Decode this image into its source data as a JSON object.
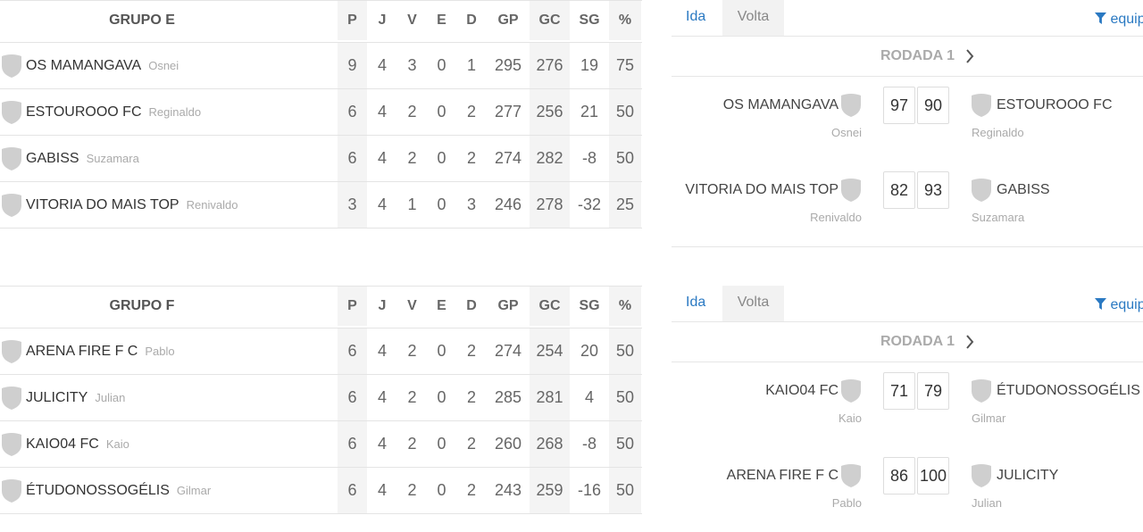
{
  "standings_columns": [
    "P",
    "J",
    "V",
    "E",
    "D",
    "GP",
    "GC",
    "SG",
    "%"
  ],
  "groups": [
    {
      "title": "GRUPO E",
      "rows": [
        {
          "team": "OS MAMANGAVA",
          "owner": "Osnei",
          "stats": [
            "9",
            "4",
            "3",
            "0",
            "1",
            "295",
            "276",
            "19",
            "75"
          ]
        },
        {
          "team": "ESTOUROOO FC",
          "owner": "Reginaldo",
          "stats": [
            "6",
            "4",
            "2",
            "0",
            "2",
            "277",
            "256",
            "21",
            "50"
          ]
        },
        {
          "team": "GABISS",
          "owner": "Suzamara",
          "stats": [
            "6",
            "4",
            "2",
            "0",
            "2",
            "274",
            "282",
            "-8",
            "50"
          ]
        },
        {
          "team": "VITORIA DO MAIS TOP",
          "owner": "Renivaldo",
          "stats": [
            "3",
            "4",
            "1",
            "0",
            "3",
            "246",
            "278",
            "-32",
            "25"
          ]
        }
      ]
    },
    {
      "title": "GRUPO F",
      "rows": [
        {
          "team": "ARENA FIRE F C",
          "owner": "Pablo",
          "stats": [
            "6",
            "4",
            "2",
            "0",
            "2",
            "274",
            "254",
            "20",
            "50"
          ]
        },
        {
          "team": "JULICITY",
          "owner": "Julian",
          "stats": [
            "6",
            "4",
            "2",
            "0",
            "2",
            "285",
            "281",
            "4",
            "50"
          ]
        },
        {
          "team": "KAIO04 FC",
          "owner": "Kaio",
          "stats": [
            "6",
            "4",
            "2",
            "0",
            "2",
            "260",
            "268",
            "-8",
            "50"
          ]
        },
        {
          "team": "ÉTUDONOSSOGÉLIS",
          "owner": "Gilmar",
          "stats": [
            "6",
            "4",
            "2",
            "0",
            "2",
            "243",
            "259",
            "-16",
            "50"
          ]
        }
      ]
    }
  ],
  "panels": [
    {
      "tabs": {
        "ida": "Ida",
        "volta": "Volta"
      },
      "filter_label": "equip",
      "round_label": "RODADA 1",
      "matches": [
        {
          "home": "OS MAMANGAVA",
          "home_owner": "Osnei",
          "score_home": "97",
          "score_away": "90",
          "away": "ESTOUROOO FC",
          "away_owner": "Reginaldo"
        },
        {
          "home": "VITORIA DO MAIS TOP",
          "home_owner": "Renivaldo",
          "score_home": "82",
          "score_away": "93",
          "away": "GABISS",
          "away_owner": "Suzamara"
        }
      ]
    },
    {
      "tabs": {
        "ida": "Ida",
        "volta": "Volta"
      },
      "filter_label": "equip",
      "round_label": "RODADA 1",
      "matches": [
        {
          "home": "KAIO04 FC",
          "home_owner": "Kaio",
          "score_home": "71",
          "score_away": "79",
          "away": "ÉTUDONOSSOGÉLIS",
          "away_owner": "Gilmar"
        },
        {
          "home": "ARENA FIRE F C",
          "home_owner": "Pablo",
          "score_home": "86",
          "score_away": "100",
          "away": "JULICITY",
          "away_owner": "Julian"
        }
      ]
    }
  ],
  "icons": {
    "team_shield": "shield-icon",
    "filter": "filter-icon",
    "next_round": "chevron-right-icon"
  },
  "colors": {
    "accent": "#2a79c2",
    "shield": "#cfcfcf",
    "shaded_column": "#f4f4f4"
  }
}
